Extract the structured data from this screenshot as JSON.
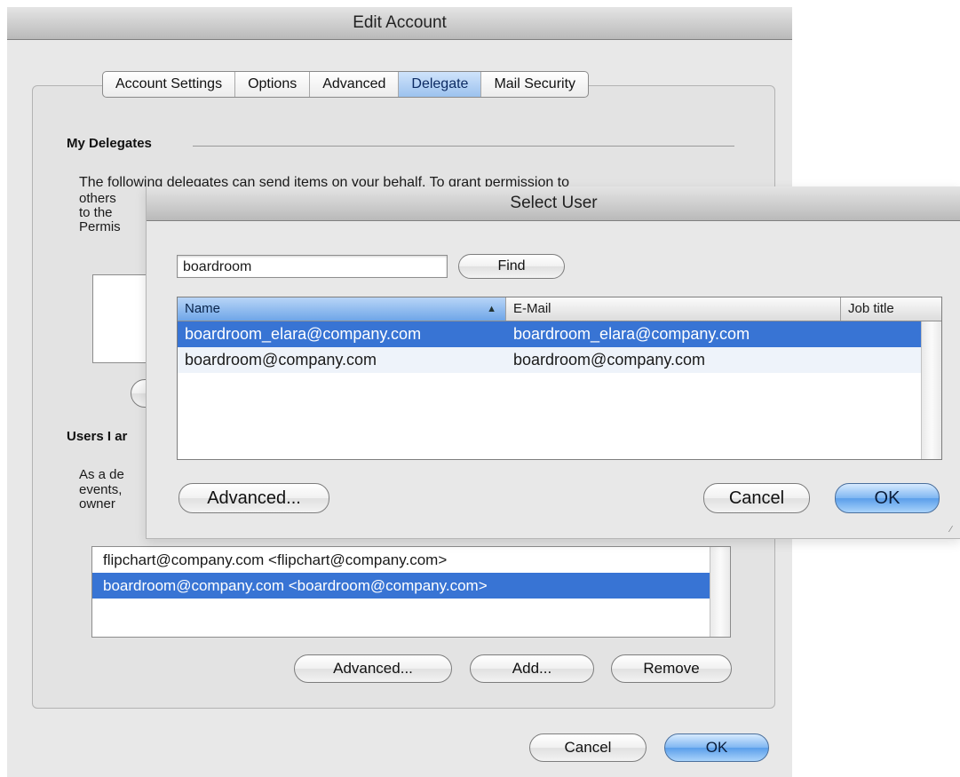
{
  "edit_account": {
    "title": "Edit Account",
    "tabs": [
      {
        "label": "Account Settings"
      },
      {
        "label": "Options"
      },
      {
        "label": "Advanced"
      },
      {
        "label": "Delegate",
        "active": true
      },
      {
        "label": "Mail Security"
      }
    ],
    "my_delegates": {
      "heading": "My Delegates",
      "description_lines": [
        "The following delegates can send items on your behalf. To grant permission to",
        "others",
        "to the",
        "Permis"
      ]
    },
    "users_i_am": {
      "heading": "Users I ar",
      "description_lines": [
        "As a de",
        "events,",
        "owner"
      ],
      "list": [
        {
          "text": "flipchart@company.com <flipchart@company.com>",
          "selected": false
        },
        {
          "text": "boardroom@company.com <boardroom@company.com>",
          "selected": true
        }
      ],
      "buttons": {
        "advanced": "Advanced...",
        "add": "Add...",
        "remove": "Remove"
      }
    },
    "footer": {
      "cancel": "Cancel",
      "ok": "OK"
    }
  },
  "select_user": {
    "title": "Select User",
    "search": {
      "value": "boardroom"
    },
    "find_button": "Find",
    "columns": [
      {
        "label": "Name",
        "sorted": true,
        "sort_indicator": "▲"
      },
      {
        "label": "E-Mail"
      },
      {
        "label": "Job title"
      }
    ],
    "rows": [
      {
        "name": "boardroom_elara@company.com",
        "email": "boardroom_elara@company.com",
        "job_title": "",
        "selected": true
      },
      {
        "name": "boardroom@company.com",
        "email": "boardroom@company.com",
        "job_title": "",
        "selected": false
      }
    ],
    "buttons": {
      "advanced": "Advanced...",
      "cancel": "Cancel",
      "ok": "OK"
    }
  }
}
